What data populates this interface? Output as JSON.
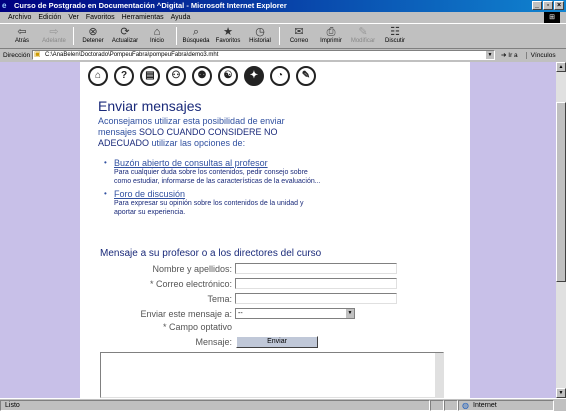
{
  "window": {
    "title": "Curso de Postgrado en Documentación ^Digital - Microsoft Internet Explorer",
    "controls": [
      "_",
      "▫",
      "×"
    ]
  },
  "menu": [
    "Archivo",
    "Edición",
    "Ver",
    "Favoritos",
    "Herramientas",
    "Ayuda"
  ],
  "toolbar": [
    {
      "label": "Atrás",
      "icon": "back-arrow-icon",
      "glyph": "⇦",
      "disabled": false
    },
    {
      "label": "Adelante",
      "icon": "forward-arrow-icon",
      "glyph": "⇨",
      "disabled": true
    },
    {
      "label": "Detener",
      "icon": "stop-icon",
      "glyph": "⊗",
      "disabled": false
    },
    {
      "label": "Actualizar",
      "icon": "refresh-icon",
      "glyph": "⟳",
      "disabled": false
    },
    {
      "label": "Inicio",
      "icon": "home-icon",
      "glyph": "⌂",
      "disabled": false
    },
    {
      "label": "Búsqueda",
      "icon": "search-icon",
      "glyph": "⌕",
      "disabled": false
    },
    {
      "label": "Favoritos",
      "icon": "favorites-icon",
      "glyph": "★",
      "disabled": false
    },
    {
      "label": "Historial",
      "icon": "history-icon",
      "glyph": "◷",
      "disabled": false
    },
    {
      "label": "Correo",
      "icon": "mail-icon",
      "glyph": "✉",
      "disabled": false
    },
    {
      "label": "Imprimir",
      "icon": "print-icon",
      "glyph": "⎙",
      "disabled": false
    },
    {
      "label": "Modificar",
      "icon": "edit-icon",
      "glyph": "✎",
      "disabled": true
    },
    {
      "label": "Discutir",
      "icon": "discuss-icon",
      "glyph": "☷",
      "disabled": false
    }
  ],
  "address": {
    "label": "Dirección",
    "url": "C:\\AnaBelen\\Doctorado\\PompeuFabra\\pompeuFabra\\demo3.mht",
    "go_label": "Ir a",
    "links_label": "Vínculos"
  },
  "nav_icons": [
    {
      "name": "home-nav-icon",
      "glyph": "⌂"
    },
    {
      "name": "help-nav-icon",
      "glyph": "?"
    },
    {
      "name": "document-nav-icon",
      "glyph": "▤"
    },
    {
      "name": "group-nav-icon",
      "glyph": "⚇"
    },
    {
      "name": "people-nav-icon",
      "glyph": "⚉"
    },
    {
      "name": "chat-nav-icon",
      "glyph": "☯"
    },
    {
      "name": "idea-nav-icon",
      "glyph": "✦"
    },
    {
      "name": "clock-nav-icon",
      "glyph": "◔"
    },
    {
      "name": "notes-nav-icon",
      "glyph": "✎"
    }
  ],
  "page": {
    "heading": "Enviar mensajes",
    "intro_1": "Aconsejamos utilizar esta posibilidad de enviar mensajes ",
    "intro_emph": "SOLO CUANDO CONSIDERE NO ADECUADO",
    "intro_2": " utilizar las opciones de:",
    "links": [
      {
        "title": "Buzón abierto de consultas al profesor",
        "desc": "Para cualquier duda sobre los contenidos, pedir consejo sobre como estudiar, informarse de las características de la evaluación..."
      },
      {
        "title": "Foro de discusión",
        "desc": "Para expresar su opinión sobre los contenidos de la unidad y aportar su experiencia."
      }
    ],
    "form_heading": "Mensaje a su profesor o a los directores del curso",
    "fields": {
      "name_label": "Nombre y apellidos:",
      "email_label": "* Correo electrónico:",
      "topic_label": "Tema:",
      "send_to_label": "Enviar este mensaje a:",
      "send_to_value": "--",
      "optional_note": "* Campo optativo",
      "message_label": "Mensaje:",
      "send_button": "Enviar"
    }
  },
  "status": {
    "text": "Listo",
    "zone": "Internet"
  }
}
